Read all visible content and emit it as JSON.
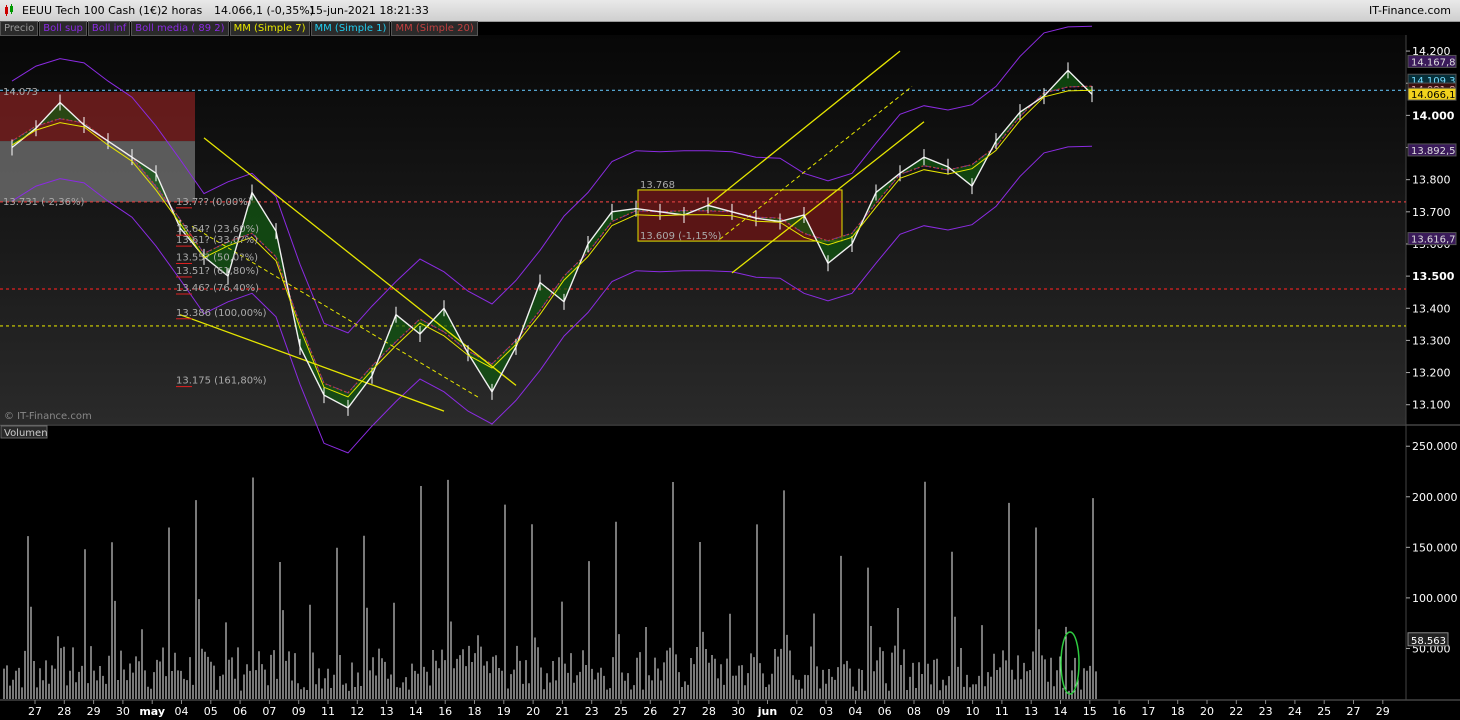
{
  "header": {
    "instrument": "EEUU Tech 100 Cash (1€)",
    "timeframe": "2 horas",
    "last_quote": "14.066,1 (-0,35%)",
    "datetime": "15-jun-2021 18:21:33",
    "brand": "IT-Finance.com"
  },
  "legend": [
    {
      "label": "Precio",
      "color": "#9a9a9a"
    },
    {
      "label": "Boll sup",
      "color": "#8b2be2"
    },
    {
      "label": "Boll inf",
      "color": "#8b2be2"
    },
    {
      "label": "Boll media ( 89 2)",
      "color": "#8b2be2"
    },
    {
      "label": "MM (Simple 7)",
      "color": "#e6e600"
    },
    {
      "label": "MM (Simple 1)",
      "color": "#22ccee"
    },
    {
      "label": "MM (Simple 20)",
      "color": "#c04040"
    }
  ],
  "watermark": "© IT-Finance.com",
  "volume_label": "Volumen",
  "chart_data": [
    {
      "type": "line",
      "title": "EEUU Tech 100 Cash (1€)",
      "xlabel": "",
      "ylabel": "",
      "ylim": [
        13040,
        14250
      ],
      "yticks": [
        13100,
        13200,
        13300,
        13400,
        13500,
        13600,
        13700,
        13800,
        13900,
        14000,
        14100,
        14200
      ],
      "ytick_labels": [
        "13.100",
        "13.200",
        "13.300",
        "13.400",
        "13.500",
        "13.600",
        "13.700",
        "13.800",
        "13.900",
        "14.000",
        "14.100",
        "14.200"
      ],
      "x_labels": [
        "27",
        "28",
        "29",
        "30",
        "may",
        "04",
        "05",
        "06",
        "07",
        "09",
        "11",
        "12",
        "13",
        "14",
        "16",
        "18",
        "19",
        "20",
        "21",
        "23",
        "25",
        "26",
        "27",
        "28",
        "30",
        "jun",
        "02",
        "03",
        "04",
        "06",
        "08",
        "09",
        "10",
        "11",
        "13",
        "14",
        "15",
        "16",
        "17",
        "18",
        "20",
        "22",
        "23",
        "24",
        "25",
        "27",
        "29"
      ],
      "series": [
        {
          "name": "Precio",
          "points": [
            [
              0,
              13900
            ],
            [
              1,
              13960
            ],
            [
              2,
              14040
            ],
            [
              3,
              13970
            ],
            [
              4,
              13920
            ],
            [
              5,
              13870
            ],
            [
              6,
              13820
            ],
            [
              7,
              13650
            ],
            [
              8,
              13560
            ],
            [
              9,
              13500
            ],
            [
              10,
              13760
            ],
            [
              11,
              13640
            ],
            [
              12,
              13280
            ],
            [
              13,
              13130
            ],
            [
              14,
              13090
            ],
            [
              15,
              13190
            ],
            [
              16,
              13380
            ],
            [
              17,
              13320
            ],
            [
              18,
              13400
            ],
            [
              19,
              13260
            ],
            [
              20,
              13140
            ],
            [
              21,
              13280
            ],
            [
              22,
              13480
            ],
            [
              23,
              13420
            ],
            [
              24,
              13600
            ],
            [
              25,
              13700
            ],
            [
              26,
              13710
            ],
            [
              27,
              13700
            ],
            [
              28,
              13690
            ],
            [
              29,
              13720
            ],
            [
              30,
              13700
            ],
            [
              31,
              13680
            ],
            [
              32,
              13670
            ],
            [
              33,
              13690
            ],
            [
              34,
              13540
            ],
            [
              35,
              13600
            ],
            [
              36,
              13760
            ],
            [
              37,
              13820
            ],
            [
              38,
              13870
            ],
            [
              39,
              13840
            ],
            [
              40,
              13780
            ],
            [
              41,
              13920
            ],
            [
              42,
              14010
            ],
            [
              43,
              14060
            ],
            [
              44,
              14140
            ],
            [
              45,
              14066
            ]
          ]
        }
      ],
      "channels": [
        {
          "name": "bajista",
          "upper": [
            [
              8,
              13930
            ],
            [
              21,
              13160
            ]
          ],
          "lower": [
            [
              7,
              13380
            ],
            [
              18,
              13080
            ]
          ]
        },
        {
          "name": "alcista",
          "upper": [
            [
              29,
              13720
            ],
            [
              37,
              14200
            ]
          ],
          "lower": [
            [
              30,
              13510
            ],
            [
              38,
              13980
            ]
          ]
        }
      ],
      "fibonacci": [
        {
          "label": "13.7?? (0,00%)",
          "price": 13731
        },
        {
          "label": "13.64? (23,60%)",
          "price": 13646
        },
        {
          "label": "13.61? (33,0?%)",
          "price": 13612
        },
        {
          "label": "13.55? (50,0?%)",
          "price": 13558
        },
        {
          "label": "13.51? (61,80%)",
          "price": 13516
        },
        {
          "label": "13.46? (76,40%)",
          "price": 13463
        },
        {
          "label": "13.386 (100,00%)",
          "price": 13386
        },
        {
          "label": "13.175 (161,80%)",
          "price": 13175
        }
      ],
      "price_box_labels": [
        {
          "label": "14.073",
          "price": 14073
        },
        {
          "label": "13.731 (-2,36%)",
          "price": 13731
        }
      ],
      "range_box_labels": [
        {
          "label": "13.768",
          "price": 13768
        },
        {
          "label": "13.609 (-1,15%)",
          "price": 13609
        }
      ],
      "levels": [
        {
          "price": 14078,
          "color": "#5fb8e8"
        },
        {
          "price": 13731,
          "color": "#d23c3c"
        },
        {
          "price": 13460,
          "color": "#e02020"
        },
        {
          "price": 13345,
          "color": "#d8d800"
        }
      ],
      "right_tags": [
        {
          "label": "14.167,8",
          "price": 14167.8,
          "bg": "#3a1a5a",
          "fg": "#ddd"
        },
        {
          "label": "14.109,3",
          "price": 14109.3,
          "bg": "#06303a",
          "fg": "#7df"
        },
        {
          "label": "14.081,8",
          "price": 14081.8,
          "bg": "#3a1010",
          "fg": "#eaa"
        },
        {
          "label": "14.066,1",
          "price": 14066.1,
          "bg": "#f2d21c",
          "fg": "#000"
        },
        {
          "label": "13.892,5",
          "price": 13892.5,
          "bg": "#3a1a5a",
          "fg": "#ddd"
        },
        {
          "label": "13.616,7",
          "price": 13616.7,
          "bg": "#3a1a5a",
          "fg": "#ddd"
        }
      ]
    },
    {
      "type": "bar",
      "title": "Volumen",
      "ylim": [
        0,
        270000
      ],
      "yticks": [
        50000,
        100000,
        150000,
        200000,
        250000
      ],
      "ytick_labels": [
        "50.000",
        "100.000",
        "150.000",
        "200.000",
        "250.000"
      ],
      "last_value": 58563,
      "last_value_label": "58.563"
    }
  ]
}
